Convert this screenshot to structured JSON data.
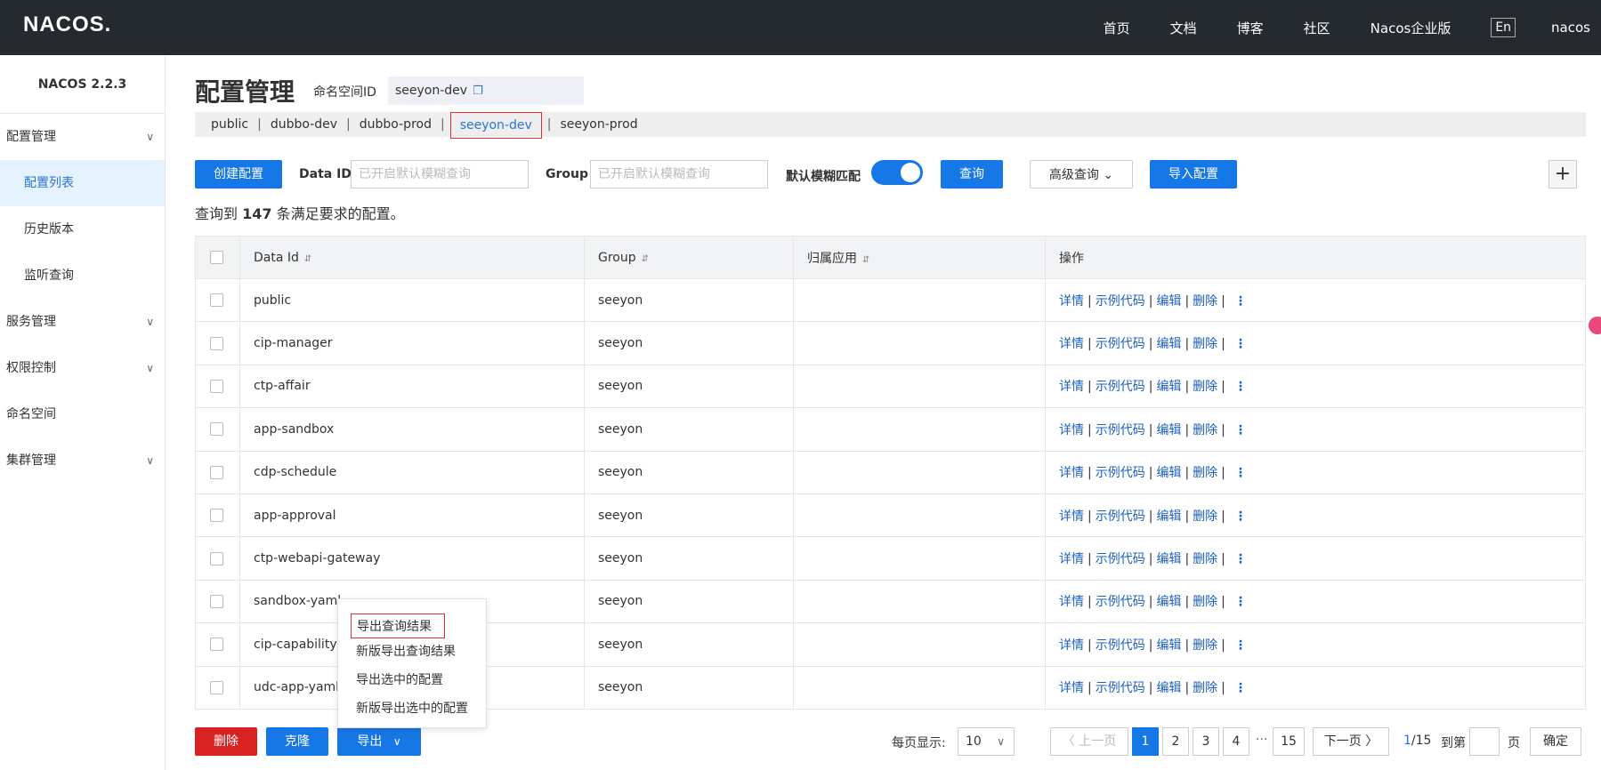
{
  "topbar": {
    "logo": "NACOS.",
    "nav": [
      "首页",
      "文档",
      "博客",
      "社区",
      "Nacos企业版"
    ],
    "lang": "En",
    "user": "nacos"
  },
  "sidebar": {
    "version": "NACOS 2.2.3",
    "items": [
      {
        "label": "配置管理",
        "chev": "∨"
      },
      {
        "label": "配置列表"
      },
      {
        "label": "历史版本"
      },
      {
        "label": "监听查询"
      },
      {
        "label": "服务管理",
        "chev": "∨"
      },
      {
        "label": "权限控制",
        "chev": "∨"
      },
      {
        "label": "命名空间"
      },
      {
        "label": "集群管理",
        "chev": "∨"
      }
    ]
  },
  "main": {
    "title": "配置管理",
    "ns_label": "命名空间ID",
    "ns_value": "seeyon-dev",
    "ns_tabs": [
      "public",
      "dubbo-dev",
      "dubbo-prod",
      "seeyon-dev",
      "seeyon-prod"
    ],
    "ns_sep": "|",
    "toolbar": {
      "create": "创建配置",
      "dataid_label": "Data ID",
      "dataid_placeholder": "已开启默认模糊查询",
      "group_label": "Group",
      "group_placeholder": "已开启默认模糊查询",
      "fuzzy_label": "默认模糊匹配",
      "query": "查询",
      "advanced": "高级查询",
      "advanced_chev": "⌄",
      "import": "导入配置",
      "plus": "+"
    },
    "summary": {
      "prefix": "查询到 ",
      "count": "147",
      "suffix": " 条满足要求的配置。"
    }
  },
  "table": {
    "headers": [
      "Data Id",
      "Group",
      "归属应用",
      "操作"
    ],
    "sort_icon": "⇵",
    "ops": [
      "详情",
      "示例代码",
      "编辑",
      "删除"
    ],
    "ops_sep": "|",
    "more": "⋮",
    "rows": [
      {
        "dataid": "public",
        "group": "seeyon",
        "app": ""
      },
      {
        "dataid": "cip-manager",
        "group": "seeyon",
        "app": ""
      },
      {
        "dataid": "ctp-affair",
        "group": "seeyon",
        "app": ""
      },
      {
        "dataid": "app-sandbox",
        "group": "seeyon",
        "app": ""
      },
      {
        "dataid": "cdp-schedule",
        "group": "seeyon",
        "app": ""
      },
      {
        "dataid": "app-approval",
        "group": "seeyon",
        "app": ""
      },
      {
        "dataid": "ctp-webapi-gateway",
        "group": "seeyon",
        "app": ""
      },
      {
        "dataid": "sandbox-yaml",
        "group": "seeyon",
        "app": ""
      },
      {
        "dataid": "cip-capability",
        "group": "seeyon",
        "app": ""
      },
      {
        "dataid": "udc-app-yaml",
        "group": "seeyon",
        "app": ""
      }
    ]
  },
  "export_menu": [
    "导出查询结果",
    "新版导出查询结果",
    "导出选中的配置",
    "新版导出选中的配置"
  ],
  "bottom": {
    "delete": "删除",
    "clone": "克隆",
    "export": "导出",
    "export_chev": "∨",
    "page_size_label": "每页显示:",
    "page_size": "10",
    "select_chev": "∨",
    "prev": "〈 上一页",
    "pages": [
      "1",
      "2",
      "3",
      "4"
    ],
    "ellipsis": "···",
    "last_page": "15",
    "next": "下一页 〉",
    "current": "1",
    "total": "/15",
    "goto_label": "到第",
    "page_unit": "页",
    "confirm": "确定"
  }
}
